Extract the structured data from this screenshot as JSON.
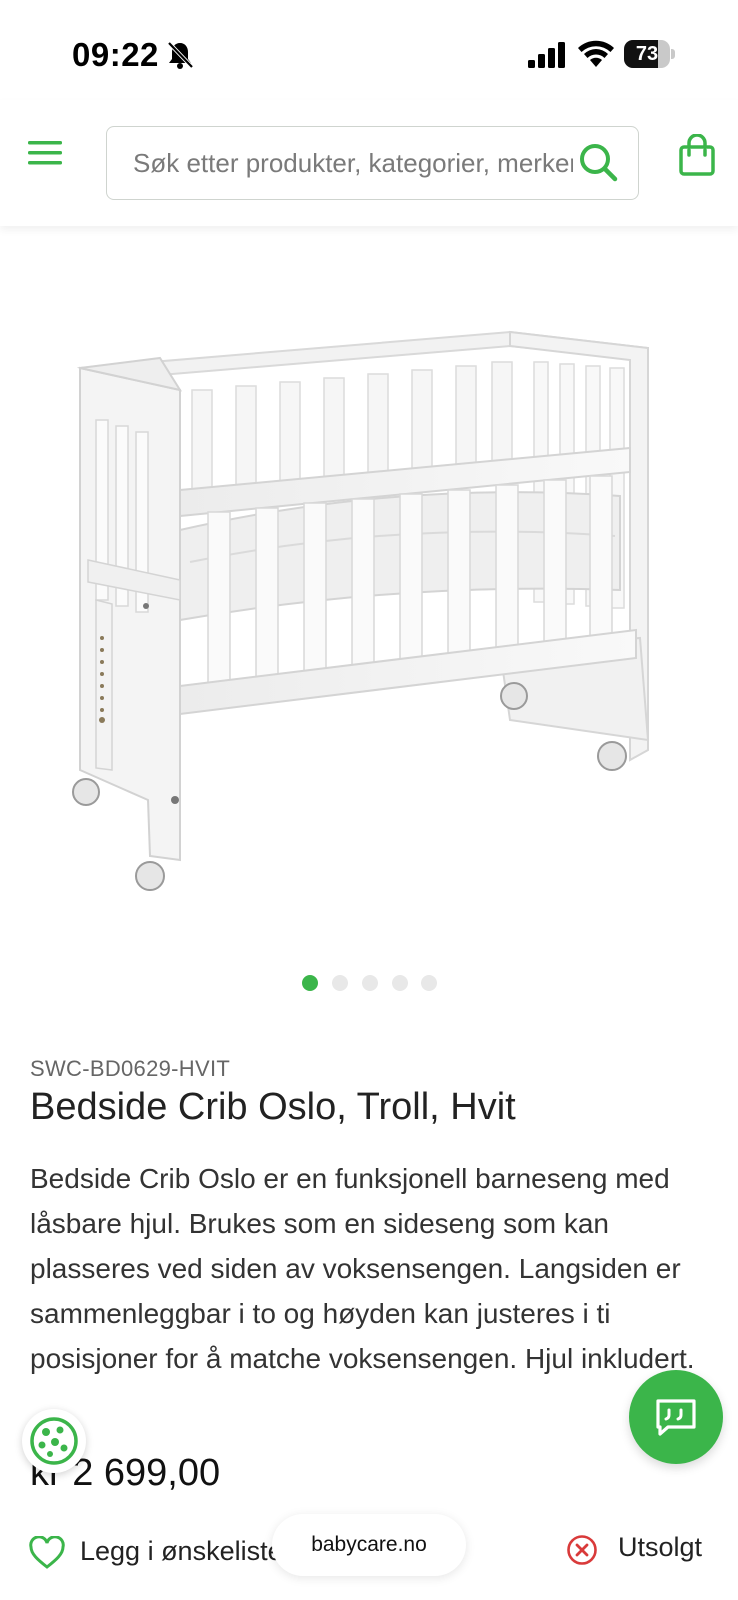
{
  "status_bar": {
    "time": "09:22",
    "battery_percent": "73",
    "battery_level": 0.73
  },
  "header": {
    "search_placeholder": "Søk etter produkter, kategorier, merker...",
    "icons": [
      "menu-icon",
      "search-icon",
      "shopping-bag-icon"
    ]
  },
  "carousel": {
    "total": 5,
    "active_index": 0
  },
  "product": {
    "sku": "SWC-BD0629-HVIT",
    "title": "Bedside Crib Oslo, Troll, Hvit",
    "description": "Bedside Crib Oslo er en funksjonell barneseng med låsbare hjul. Brukes som en sideseng som kan plasseres ved siden av voksensengen. Langsiden er sammenleggbar i to og høyden kan justeres i ti posisjoner for å matche voksensengen. Hjul inkludert.",
    "price": "kr 2 699,00"
  },
  "actions": {
    "wishlist_label": "Legg i ønskeliste",
    "stock_status": "Utsolgt"
  },
  "browser": {
    "domain": "babycare.no"
  },
  "colors": {
    "brand_green": "#3bb54a",
    "stock_red": "#d93a3a",
    "dot_inactive": "#e8e8e8"
  }
}
